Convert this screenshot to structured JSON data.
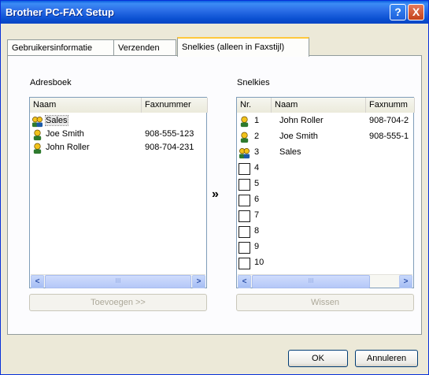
{
  "window": {
    "title": "Brother PC-FAX Setup"
  },
  "titlebar_buttons": {
    "help": "?",
    "close": "X"
  },
  "tabs": [
    {
      "label": "Gebruikersinformatie"
    },
    {
      "label": "Verzenden"
    },
    {
      "label": "Snelkies (alleen in Faxstijl)"
    }
  ],
  "addressbook": {
    "label": "Adresboek",
    "columns": [
      "Naam",
      "Faxnummer"
    ],
    "rows": [
      {
        "name": "Sales",
        "fax": "",
        "type": "group"
      },
      {
        "name": "Joe Smith",
        "fax": "908-555-123",
        "type": "person"
      },
      {
        "name": "John Roller",
        "fax": "908-704-231",
        "type": "person"
      }
    ],
    "add_button": "Toevoegen >>"
  },
  "transfer_arrow": "»",
  "speeddial": {
    "label": "Snelkies",
    "columns": [
      "Nr.",
      "Naam",
      "Faxnumm"
    ],
    "rows": [
      {
        "nr": "1",
        "name": "John Roller",
        "fax": "908-704-2",
        "type": "person"
      },
      {
        "nr": "2",
        "name": "Joe Smith",
        "fax": "908-555-1",
        "type": "person"
      },
      {
        "nr": "3",
        "name": "Sales",
        "fax": "",
        "type": "group"
      },
      {
        "nr": "4",
        "name": "",
        "fax": "",
        "type": "empty"
      },
      {
        "nr": "5",
        "name": "",
        "fax": "",
        "type": "empty"
      },
      {
        "nr": "6",
        "name": "",
        "fax": "",
        "type": "empty"
      },
      {
        "nr": "7",
        "name": "",
        "fax": "",
        "type": "empty"
      },
      {
        "nr": "8",
        "name": "",
        "fax": "",
        "type": "empty"
      },
      {
        "nr": "9",
        "name": "",
        "fax": "",
        "type": "empty"
      },
      {
        "nr": "10",
        "name": "",
        "fax": "",
        "type": "empty"
      }
    ],
    "clear_button": "Wissen"
  },
  "footer": {
    "ok": "OK",
    "cancel": "Annuleren"
  },
  "scroll_glyphs": {
    "left": "<",
    "right": ">",
    "thumb": "III"
  }
}
